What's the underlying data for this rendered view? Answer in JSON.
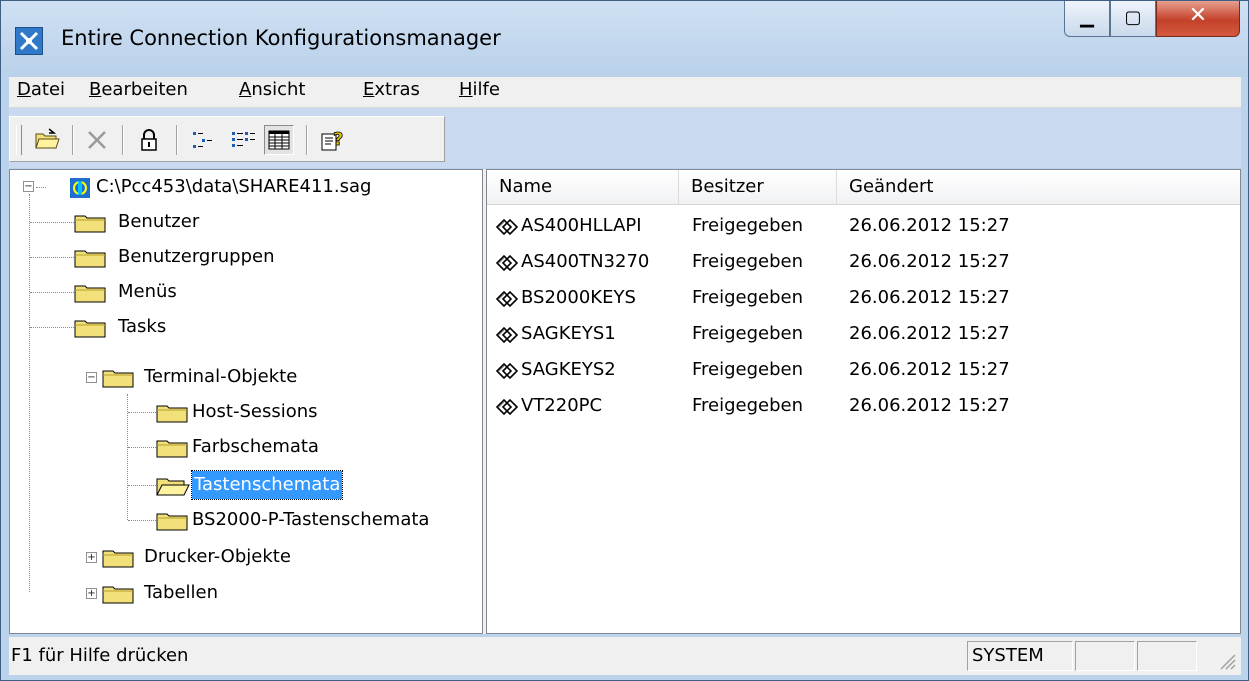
{
  "window": {
    "title": "Entire Connection Konfigurationsmanager"
  },
  "menu": [
    {
      "label": "Datei",
      "u": "D",
      "rest": "atei"
    },
    {
      "label": "Bearbeiten",
      "u": "B",
      "rest": "earbeiten"
    },
    {
      "label": "Ansicht",
      "u": "A",
      "rest": "nsicht"
    },
    {
      "label": "Extras",
      "u": "E",
      "rest": "xtras"
    },
    {
      "label": "Hilfe",
      "u": "H",
      "rest": "ilfe"
    }
  ],
  "toolbar": {
    "icons": [
      "open-folder-icon",
      "delete-icon",
      "lock-icon",
      "large-icons-view-icon",
      "list-view-icon",
      "details-view-icon",
      "help-icon"
    ]
  },
  "tree": {
    "root": "C:\\Pcc453\\data\\SHARE411.sag",
    "items": [
      "Benutzer",
      "Benutzergruppen",
      "Menüs",
      "Tasks",
      "Terminal-Objekte",
      "Host-Sessions",
      "Farbschemata",
      "Tastenschemata",
      "BS2000-P-Tastenschemata",
      "Drucker-Objekte",
      "Tabellen"
    ]
  },
  "list": {
    "columns": [
      "Name",
      "Besitzer",
      "Geändert"
    ],
    "rows": [
      {
        "name": "AS400HLLAPI",
        "owner": "Freigegeben",
        "changed": "26.06.2012 15:27"
      },
      {
        "name": "AS400TN3270",
        "owner": "Freigegeben",
        "changed": "26.06.2012 15:27"
      },
      {
        "name": "BS2000KEYS",
        "owner": "Freigegeben",
        "changed": "26.06.2012 15:27"
      },
      {
        "name": "SAGKEYS1",
        "owner": "Freigegeben",
        "changed": "26.06.2012 15:27"
      },
      {
        "name": "SAGKEYS2",
        "owner": "Freigegeben",
        "changed": "26.06.2012 15:27"
      },
      {
        "name": "VT220PC",
        "owner": "Freigegeben",
        "changed": "26.06.2012 15:27"
      }
    ]
  },
  "status": {
    "text": "F1 für Hilfe drücken",
    "user": "SYSTEM"
  },
  "colors": {
    "selection": "#3399ff",
    "folder": "#f2e17a",
    "titlebar": "#bcd3ec"
  }
}
